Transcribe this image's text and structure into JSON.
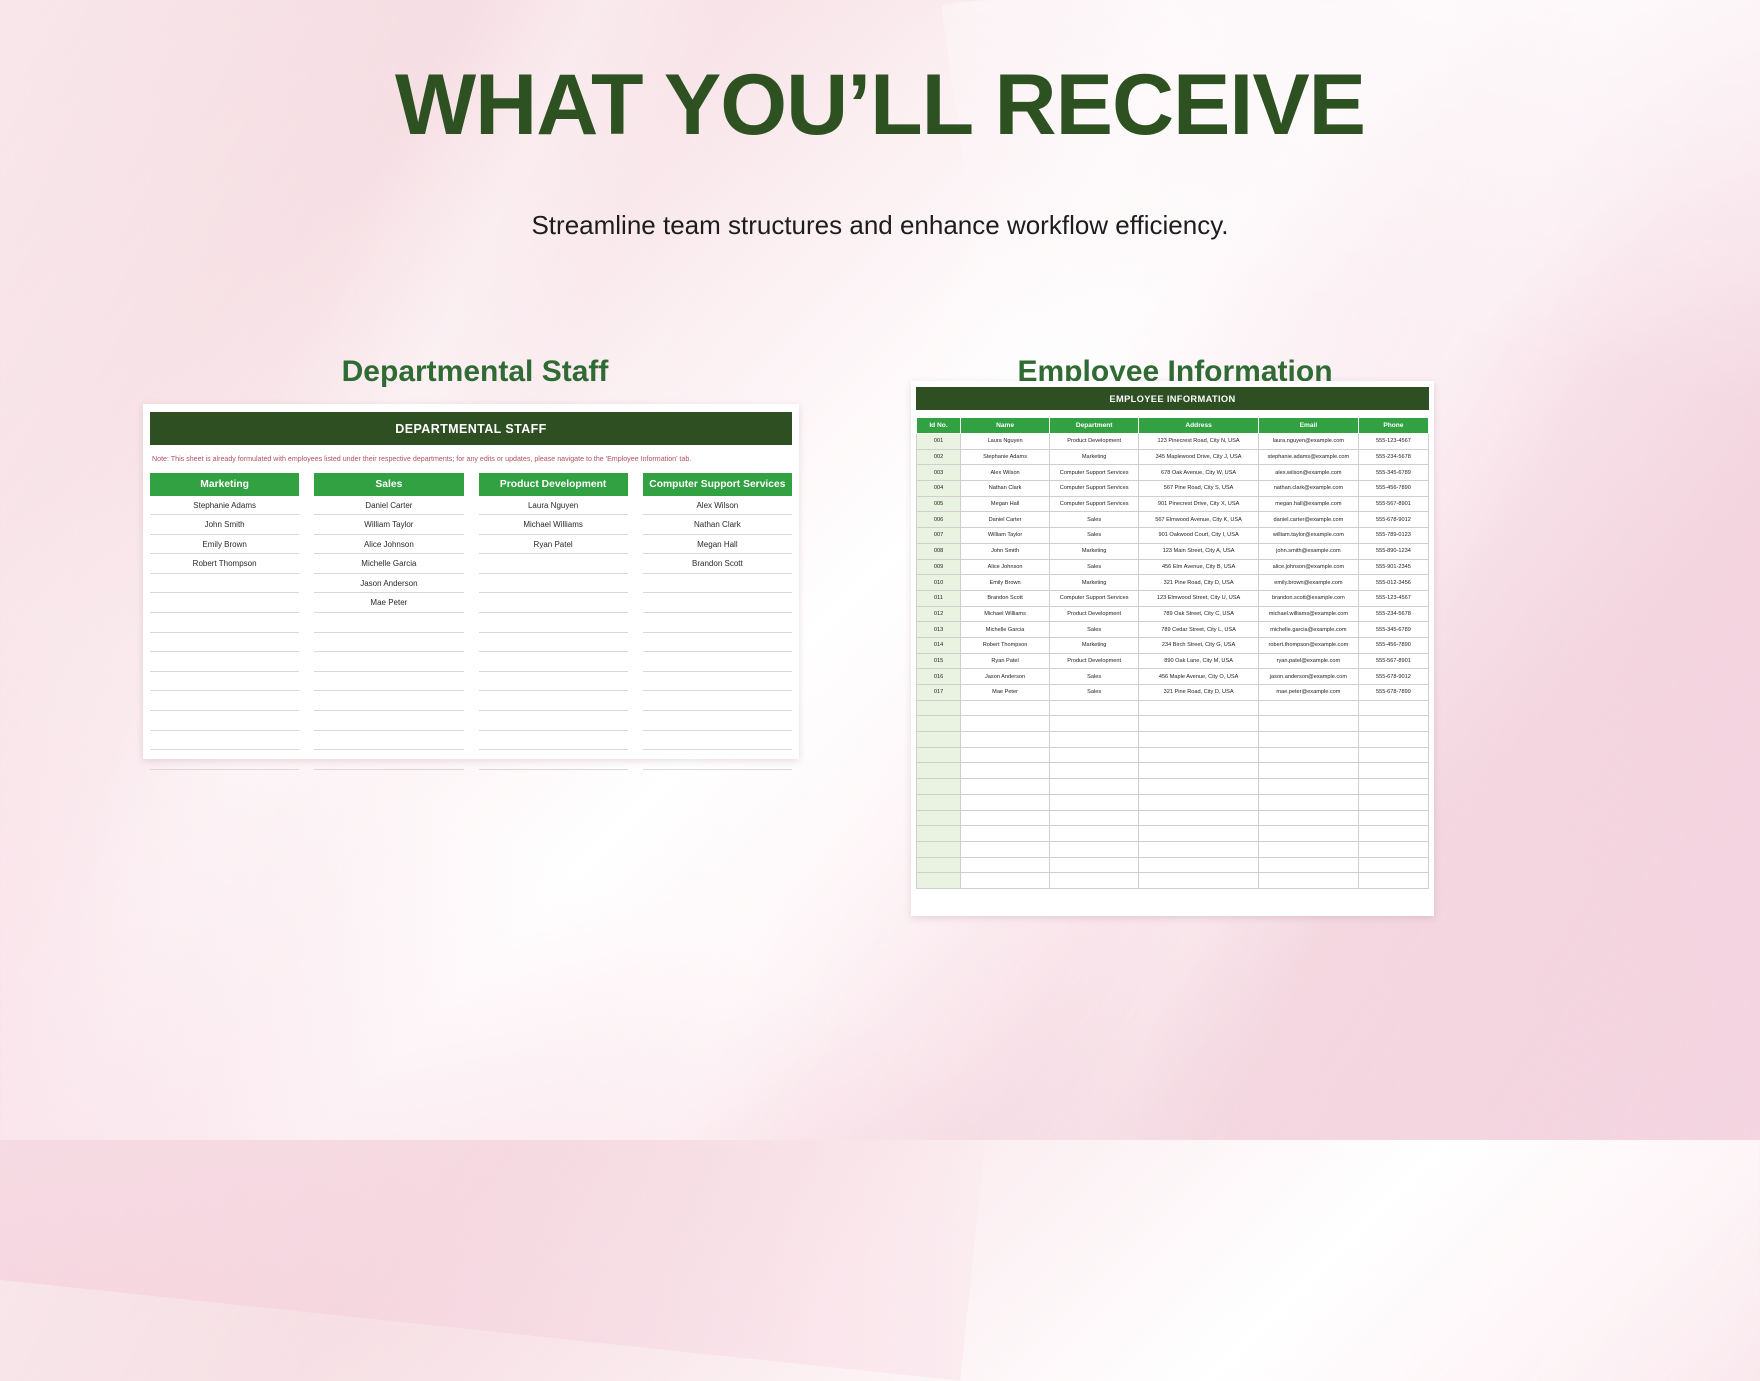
{
  "hero": {
    "title": "WHAT YOU’LL RECEIVE",
    "subtitle": "Streamline team structures and enhance workflow efficiency."
  },
  "sections": {
    "left_title": "Departmental Staff",
    "right_title": "Employee Information"
  },
  "colors": {
    "dark_green": "#2d4f21",
    "green": "#31a142",
    "title_green": "#2e5121",
    "section_green": "#2f6b33",
    "note_red": "#b5505f",
    "id_cell_bg": "#eaf3e2"
  },
  "departmental_staff": {
    "banner": "DEPARTMENTAL STAFF",
    "note": "Note:  This sheet is already formulated with employees listed under their respective departments; for any edits or updates, please navigate to the 'Employee Information' tab.",
    "columns": [
      {
        "header": "Marketing",
        "names": [
          "Stephanie Adams",
          "John Smith",
          "Emily Brown",
          "Robert Thompson"
        ]
      },
      {
        "header": "Sales",
        "names": [
          "Daniel Carter",
          "William Taylor",
          "Alice Johnson",
          "Michelle Garcia",
          "Jason Anderson",
          "Mae Peter"
        ]
      },
      {
        "header": "Product Development",
        "names": [
          "Laura Nguyen",
          "Michael Williams",
          "Ryan Patel"
        ]
      },
      {
        "header": "Computer Support Services",
        "names": [
          "Alex Wilson",
          "Nathan Clark",
          "Megan Hall",
          "Brandon Scott"
        ]
      }
    ],
    "total_rows": 14
  },
  "employee_information": {
    "banner": "EMPLOYEE INFORMATION",
    "headers": [
      "Id No.",
      "Name",
      "Department",
      "Address",
      "Email",
      "Phone"
    ],
    "rows": [
      [
        "001",
        "Laura Nguyen",
        "Product Development",
        "123 Pinecrest Road, City N, USA",
        "laura.nguyen@example.com",
        "555-123-4567"
      ],
      [
        "002",
        "Stephanie Adams",
        "Marketing",
        "345 Maplewood Drive, City J, USA",
        "stephanie.adams@example.com",
        "555-234-5678"
      ],
      [
        "003",
        "Alex Wilson",
        "Computer Support Services",
        "678 Oak Avenue, City W, USA",
        "alex.wilson@example.com",
        "555-345-6789"
      ],
      [
        "004",
        "Nathan Clark",
        "Computer Support Services",
        "567 Pine Road, City S, USA",
        "nathan.clark@example.com",
        "555-456-7890"
      ],
      [
        "005",
        "Megan Hall",
        "Computer Support Services",
        "901 Pinecrest Drive, City X, USA",
        "megan.hall@example.com",
        "555-567-8901"
      ],
      [
        "006",
        "Daniel Carter",
        "Sales",
        "567 Elmwood Avenue, City K, USA",
        "daniel.carter@example.com",
        "555-678-9012"
      ],
      [
        "007",
        "William Taylor",
        "Sales",
        "901 Oakwood Court, City I, USA",
        "william.taylor@example.com",
        "555-789-0123"
      ],
      [
        "008",
        "John Smith",
        "Marketing",
        "123 Main Street, City A, USA",
        "john.smith@example.com",
        "555-890-1234"
      ],
      [
        "009",
        "Alice Johnson",
        "Sales",
        "456 Elm Avenue, City B, USA",
        "alice.johnson@example.com",
        "555-901-2345"
      ],
      [
        "010",
        "Emily Brown",
        "Marketing",
        "321 Pine Road, City D, USA",
        "emily.brown@example.com",
        "555-012-3456"
      ],
      [
        "011",
        "Brandon Scott",
        "Computer Support Services",
        "123 Elmwood Street, City U, USA",
        "brandon.scott@example.com",
        "555-123-4567"
      ],
      [
        "012",
        "Michael Williams",
        "Product Development",
        "789 Oak Street, City C, USA",
        "michael.williams@example.com",
        "555-234-5678"
      ],
      [
        "013",
        "Michelle Garcia",
        "Sales",
        "789 Cedar Street, City L, USA",
        "michelle.garcia@example.com",
        "555-345-6789"
      ],
      [
        "014",
        "Robert Thompson",
        "Marketing",
        "234 Birch Street, City G, USA",
        "robert.thompson@example.com",
        "555-456-7890"
      ],
      [
        "015",
        "Ryan Patel",
        "Product Development",
        "890 Oak Lane, City M, USA",
        "ryan.patel@example.com",
        "555-567-8901"
      ],
      [
        "016",
        "Jason Anderson",
        "Sales",
        "456 Maple Avenue, City O, USA",
        "jason.anderson@example.com",
        "555-678-9012"
      ],
      [
        "017",
        "Mae Peter",
        "Sales",
        "321 Pine Road, City D, USA",
        "mae.peter@example.com",
        "555-678-7899"
      ]
    ],
    "blank_rows": 12
  }
}
